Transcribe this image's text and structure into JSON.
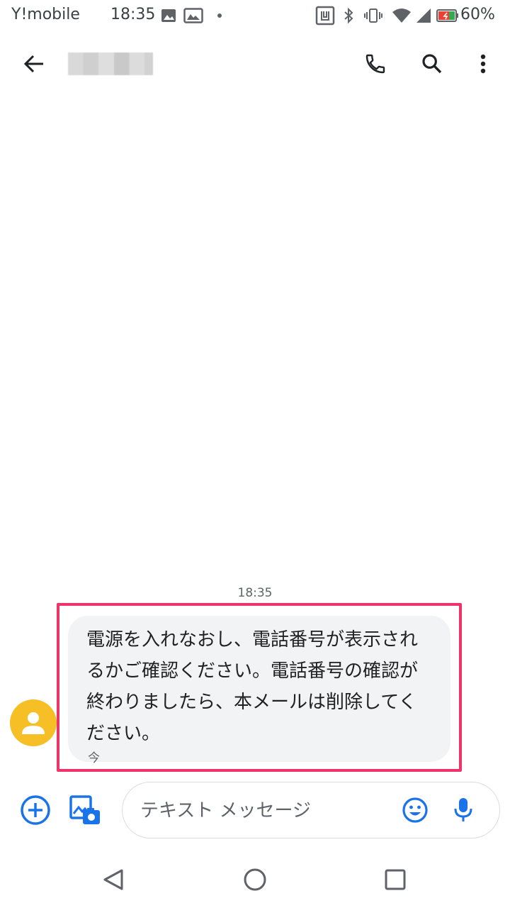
{
  "status_bar": {
    "carrier": "Y!mobile",
    "time": "18:35",
    "battery_percent": "60%",
    "icons": [
      "image-icon",
      "gallery-icon",
      "dot-icon",
      "nfc-icon",
      "bluetooth-icon",
      "vibrate-icon",
      "wifi-icon",
      "signal-icon",
      "battery-icon"
    ]
  },
  "app_bar": {
    "contact_name": "",
    "icons": [
      "back-arrow-icon",
      "phone-icon",
      "search-icon",
      "more-vert-icon"
    ]
  },
  "conversation": {
    "timestamp": "18:35",
    "messages": [
      {
        "text": "電源を入れなおし、電話番号が表示されるかご確認ください。電話番号の確認が終わりましたら、本メールは削除してください。",
        "status": "今",
        "direction": "incoming"
      }
    ],
    "highlight_color": "#f0336b",
    "avatar_color": "#f6bf26"
  },
  "compose": {
    "placeholder": "テキスト メッセージ",
    "icons": [
      "add-circle-icon",
      "gallery-camera-icon",
      "emoji-icon",
      "mic-icon"
    ],
    "accent_color": "#1a73e8"
  },
  "nav_bar": {
    "icons": [
      "back-triangle-icon",
      "home-circle-icon",
      "recents-square-icon"
    ]
  }
}
